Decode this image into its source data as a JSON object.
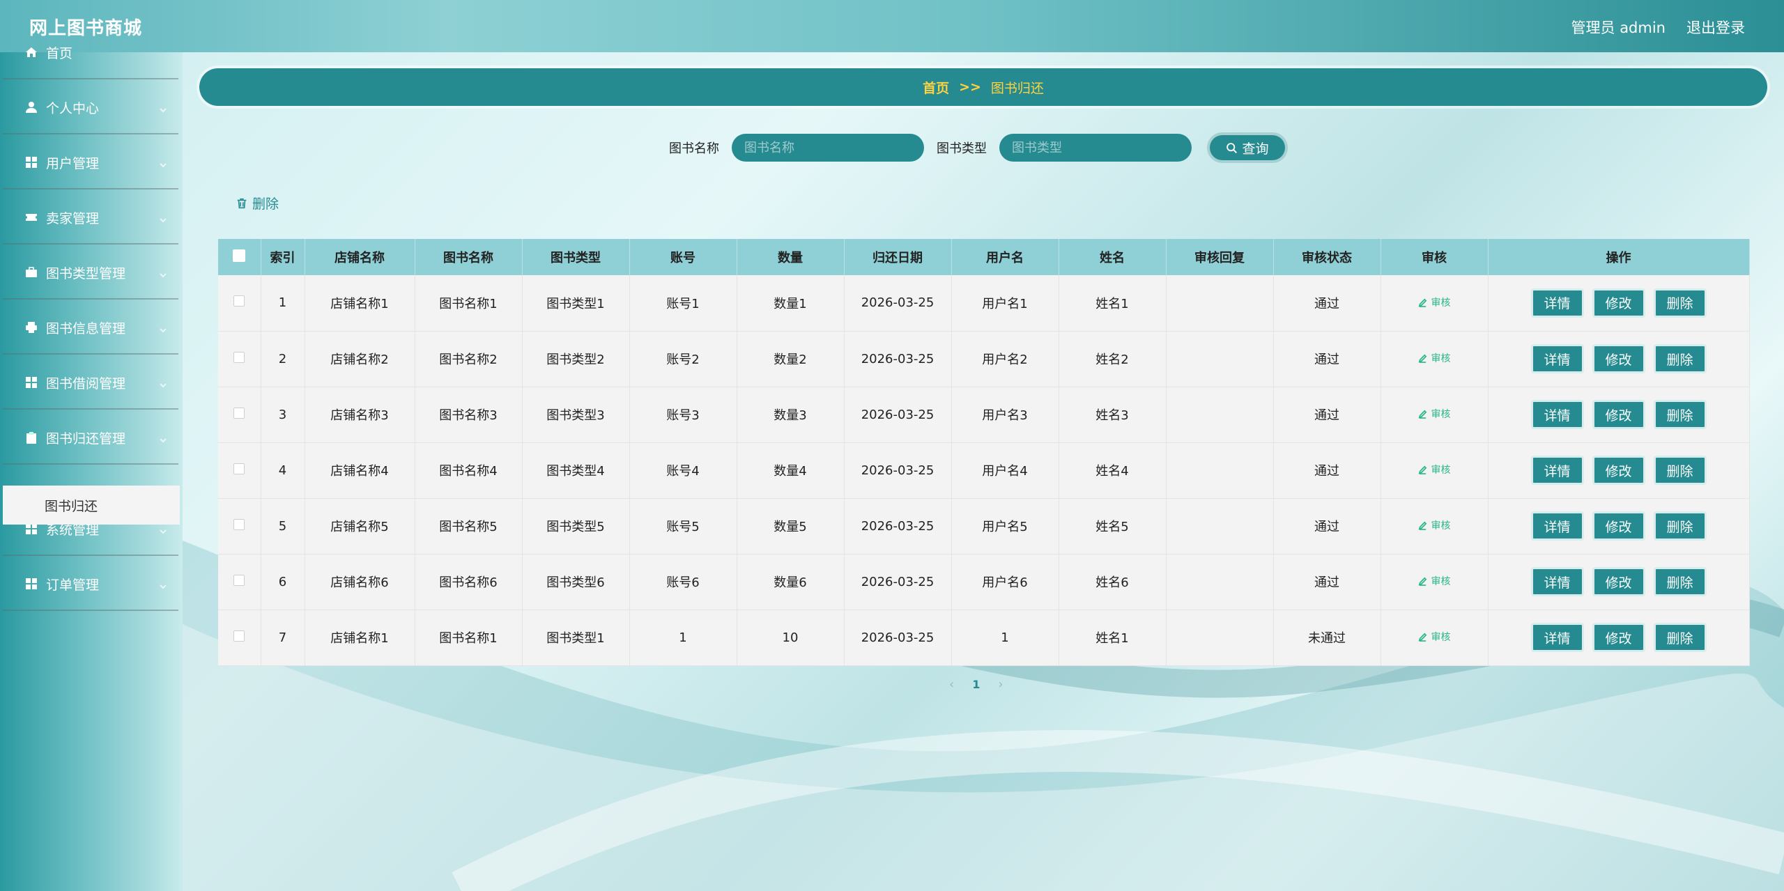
{
  "app_title": "网上图书商城",
  "header": {
    "user_label": "管理员 admin",
    "logout_label": "退出登录"
  },
  "sidebar": {
    "items": [
      {
        "label": "首页",
        "icon": "home-icon"
      },
      {
        "label": "个人中心",
        "icon": "user-icon"
      },
      {
        "label": "用户管理",
        "icon": "grid-icon"
      },
      {
        "label": "卖家管理",
        "icon": "ticket-icon"
      },
      {
        "label": "图书类型管理",
        "icon": "briefcase-icon"
      },
      {
        "label": "图书信息管理",
        "icon": "printer-icon"
      },
      {
        "label": "图书借阅管理",
        "icon": "grid-icon"
      },
      {
        "label": "图书归还管理",
        "icon": "clipboard-icon"
      },
      {
        "label": "系统管理",
        "icon": "grid-icon"
      },
      {
        "label": "订单管理",
        "icon": "grid-icon"
      }
    ],
    "active_sub": "图书归还"
  },
  "breadcrumb": {
    "home": "首页",
    "sep": ">>",
    "current": "图书归还"
  },
  "search": {
    "name_label": "图书名称",
    "name_placeholder": "图书名称",
    "type_label": "图书类型",
    "type_placeholder": "图书类型",
    "query_label": "查询"
  },
  "toolbar": {
    "delete_label": "删除"
  },
  "table": {
    "headers": [
      "索引",
      "店铺名称",
      "图书名称",
      "图书类型",
      "账号",
      "数量",
      "归还日期",
      "用户名",
      "姓名",
      "审核回复",
      "审核状态",
      "审核",
      "操作"
    ],
    "audit_label": "审核",
    "op_labels": [
      "详情",
      "修改",
      "删除"
    ],
    "rows": [
      [
        "1",
        "店铺名称1",
        "图书名称1",
        "图书类型1",
        "账号1",
        "数量1",
        "2026-03-25",
        "用户名1",
        "姓名1",
        "",
        "通过"
      ],
      [
        "2",
        "店铺名称2",
        "图书名称2",
        "图书类型2",
        "账号2",
        "数量2",
        "2026-03-25",
        "用户名2",
        "姓名2",
        "",
        "通过"
      ],
      [
        "3",
        "店铺名称3",
        "图书名称3",
        "图书类型3",
        "账号3",
        "数量3",
        "2026-03-25",
        "用户名3",
        "姓名3",
        "",
        "通过"
      ],
      [
        "4",
        "店铺名称4",
        "图书名称4",
        "图书类型4",
        "账号4",
        "数量4",
        "2026-03-25",
        "用户名4",
        "姓名4",
        "",
        "通过"
      ],
      [
        "5",
        "店铺名称5",
        "图书名称5",
        "图书类型5",
        "账号5",
        "数量5",
        "2026-03-25",
        "用户名5",
        "姓名5",
        "",
        "通过"
      ],
      [
        "6",
        "店铺名称6",
        "图书名称6",
        "图书类型6",
        "账号6",
        "数量6",
        "2026-03-25",
        "用户名6",
        "姓名6",
        "",
        "通过"
      ],
      [
        "7",
        "店铺名称1",
        "图书名称1",
        "图书类型1",
        "1",
        "10",
        "2026-03-25",
        "1",
        "姓名1",
        "",
        "未通过"
      ]
    ]
  },
  "pager": {
    "prev": "‹",
    "current": "1",
    "next": "›"
  },
  "colors": {
    "primary": "#258b90",
    "header_bg": "#8fd0d6",
    "breadcrumb_text": "#ffd23f",
    "audit_link": "#2bb58a"
  }
}
